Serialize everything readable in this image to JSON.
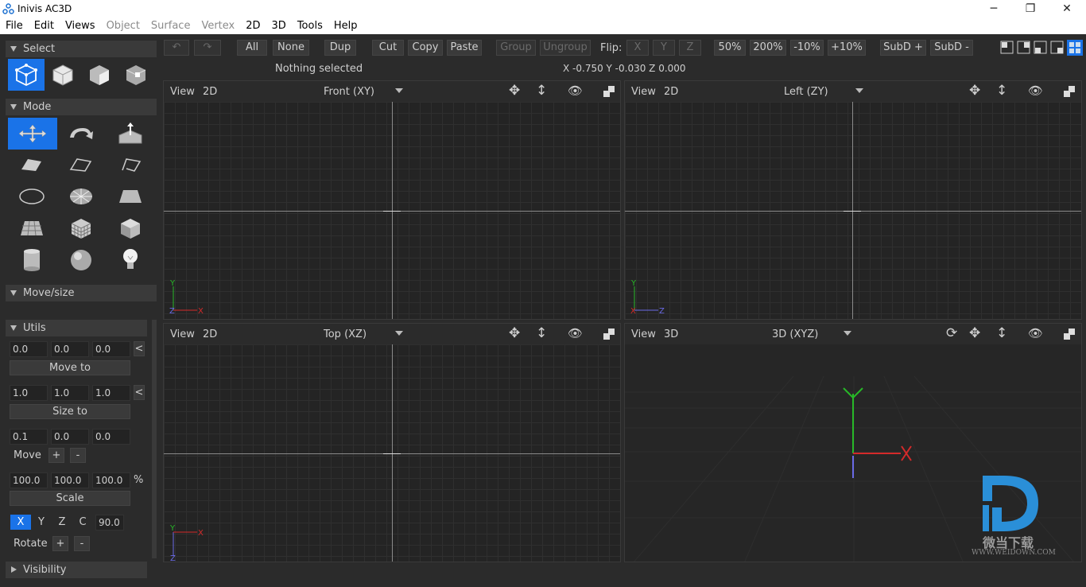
{
  "window": {
    "title": "Inivis AC3D",
    "minimize": "─",
    "maximize": "❐",
    "close": "✕"
  },
  "menu": [
    {
      "label": "File",
      "enabled": true
    },
    {
      "label": "Edit",
      "enabled": true
    },
    {
      "label": "Views",
      "enabled": true
    },
    {
      "label": "Object",
      "enabled": false
    },
    {
      "label": "Surface",
      "enabled": false
    },
    {
      "label": "Vertex",
      "enabled": false
    },
    {
      "label": "2D",
      "enabled": true
    },
    {
      "label": "3D",
      "enabled": true
    },
    {
      "label": "Tools",
      "enabled": true
    },
    {
      "label": "Help",
      "enabled": true
    }
  ],
  "toolbar": {
    "undo_icon": "undo-icon",
    "redo_icon": "redo-icon",
    "all": "All",
    "none": "None",
    "dup": "Dup",
    "cut": "Cut",
    "copy": "Copy",
    "paste": "Paste",
    "group": "Group",
    "ungroup": "Ungroup",
    "flip_label": "Flip:",
    "flip_x": "X",
    "flip_y": "Y",
    "flip_z": "Z",
    "zoom50": "50%",
    "zoom200": "200%",
    "zoom_minus10": "-10%",
    "zoom_plus10": "+10%",
    "subd_plus": "SubD +",
    "subd_minus": "SubD -",
    "selection_status": "Nothing selected",
    "coords": "X -0.750 Y -0.030 Z 0.000"
  },
  "panels": {
    "select": "Select",
    "mode": "Mode",
    "movesize": "Move/size",
    "utils": "Utils",
    "visibility": "Visibility"
  },
  "utils": {
    "pos": [
      "0.0",
      "0.0",
      "0.0"
    ],
    "move_to": "Move to",
    "size": [
      "1.0",
      "1.0",
      "1.0"
    ],
    "size_to": "Size to",
    "move_amt": [
      "0.1",
      "0.0",
      "0.0"
    ],
    "move_label": "Move",
    "plus": "+",
    "minus": "-",
    "scale_vals": [
      "100.0",
      "100.0",
      "100.0"
    ],
    "percent": "%",
    "scale": "Scale",
    "axis_x": "X",
    "axis_y": "Y",
    "axis_z": "Z",
    "axis_c": "C",
    "angle": "90.0",
    "rotate_label": "Rotate",
    "back": "<"
  },
  "viewports": [
    {
      "view": "View",
      "mode": "2D",
      "name": "Front (XY)"
    },
    {
      "view": "View",
      "mode": "2D",
      "name": "Left (ZY)"
    },
    {
      "view": "View",
      "mode": "2D",
      "name": "Top (XZ)"
    },
    {
      "view": "View",
      "mode": "3D",
      "name": "3D (XYZ)"
    }
  ],
  "axis_labels": {
    "x": "X",
    "y": "Y",
    "z": "Z"
  },
  "watermark": {
    "text_cn": "微当下载",
    "text_en": "WWW.WEIDOWN.COM"
  },
  "colors": {
    "accent": "#1a73e8",
    "x_axis": "#d42a2a",
    "y_axis": "#27b827",
    "z_axis": "#4b4bd6"
  }
}
